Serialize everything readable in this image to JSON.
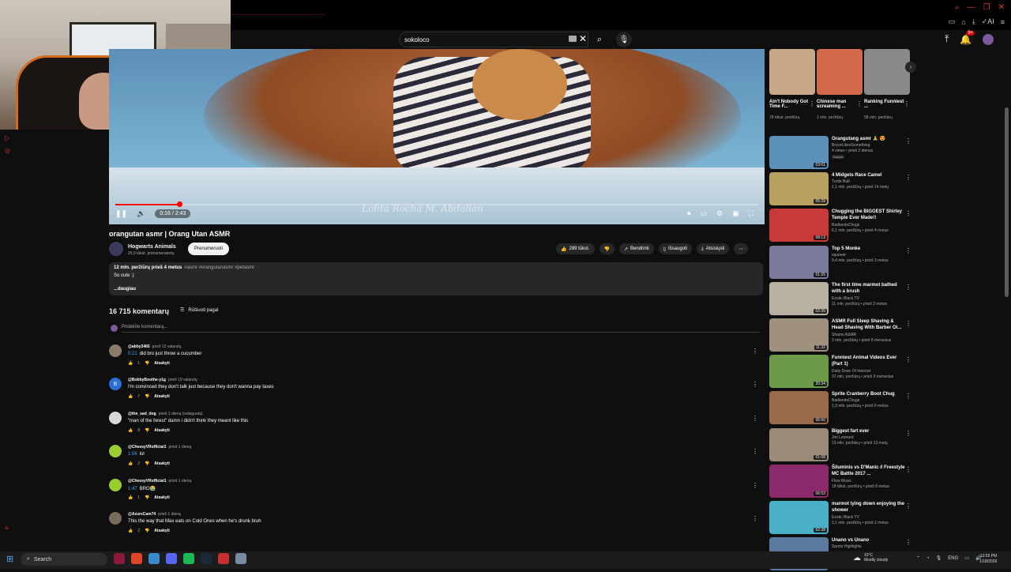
{
  "search": {
    "value": "sokoloco"
  },
  "player": {
    "watermark": "Lolita Rocha M. Abdalian",
    "time": "0:16 / 2:43",
    "progress_fraction": 0.1
  },
  "video": {
    "title": "orangutan asmr | Orang Utan ASMR",
    "channel_name": "Hogwarts Animals",
    "channel_subs": "25,9 tūkst. prenumeratorių",
    "subscribe_label": "Prenumeruoti",
    "likes": "289 tūkst.",
    "share_label": "Bendrinti",
    "save_label": "Išsaugoti",
    "download_label": "Atsisiųsti"
  },
  "description": {
    "meta": "12 mln. peržiūrų prieš 4 metus",
    "tags": "#asmr #orangutanasmr #petasmr",
    "text": "So cute :)",
    "more_label": "...daugiau"
  },
  "comments": {
    "count_label": "16 715 komentarų",
    "sort_label": "Rūšiuoti pagal",
    "add_placeholder": "Pridėkite komentarą...",
    "items": [
      {
        "author": "@abby3465",
        "time": "prieš 13 valandų",
        "timestamp": "0:21",
        "text": "did bro just throw a cucumber",
        "likes": "1",
        "reply": "Atsakyti",
        "avatar_color": "#8a7a6a"
      },
      {
        "author": "@BobbyBoothe-y1g",
        "time": "prieš 19 valandų",
        "timestamp": "",
        "text": "I'm convinced they don't talk just because they don't wanna pay taxes",
        "likes": "7",
        "reply": "Atsakyti",
        "avatar_color": "#2a6fd6",
        "avatar_letter": "B"
      },
      {
        "author": "@the_sad_dog",
        "time": "prieš 1 dieną (redaguota)",
        "timestamp": "",
        "text": "\"man of the forest\" damn i didn't think they meant like this",
        "likes": "8",
        "reply": "Atsakyti",
        "avatar_color": "#d8d8d8"
      },
      {
        "author": "@CheesyVRofficial1",
        "time": "prieš 1 dieną",
        "timestamp": "1:56",
        "text": "lol",
        "likes": "2",
        "reply": "Atsakyti",
        "avatar_color": "#9acd32"
      },
      {
        "author": "@CheesyVRofficial1",
        "time": "prieš 1 dieną",
        "timestamp": "1:47",
        "text": "BRO😭",
        "likes": "1",
        "reply": "Atsakyti",
        "avatar_color": "#9acd32"
      },
      {
        "author": "@AzureCam74",
        "time": "prieš 1 dieną",
        "timestamp": "",
        "text": "This the way that Max eats on Cold Ones when he's drunk bruh",
        "likes": "2",
        "reply": "Atsakyti",
        "avatar_color": "#7a6a5a"
      }
    ]
  },
  "shorts": [
    {
      "title": "Ain't Nobody Got Time F...",
      "views": "78 tūkst. peržiūrų",
      "color": "#c8a888"
    },
    {
      "title": "Chinese man screaming ...",
      "views": "1 mln. peržiūrų",
      "color": "#d06a4a"
    },
    {
      "title": "Ranking Funniest ...",
      "views": "58 mln. peržiūrų",
      "color": "#8a8a8a"
    }
  ],
  "recommendations": [
    {
      "title": "Orangutang asmr 🙏 😍",
      "channel": "BryceLikesSomething",
      "meta": "4 views • prieš 2 dienas",
      "badge": "Naujas",
      "duration": "03:01",
      "color": "#5b90b8"
    },
    {
      "title": "4 Midgets Race Camel",
      "channel": "Turtle Butt",
      "meta": "1,1 mln. peržiūrų • prieš 14 metų",
      "badge": "",
      "duration": "05:39",
      "color": "#b8a060"
    },
    {
      "title": "Chugging the BIGGEST Shirley Temple Ever Made!!",
      "channel": "BadlandsChugs",
      "meta": "6,1 mln. peržiūrų • prieš 4 metus",
      "badge": "",
      "duration": "08:13",
      "color": "#c83a3a"
    },
    {
      "title": "Top 5 Monke",
      "channel": "squeeer",
      "meta": "9,4 mln. peržiūrų • prieš 3 metus",
      "badge": "",
      "duration": "01:25",
      "color": "#7a7a9a"
    },
    {
      "title": "The first time marmot bathed with a brush",
      "channel": "Exotic Black TV",
      "meta": "11 mln. peržiūrų • prieš 2 metus",
      "badge": "",
      "duration": "02:35",
      "color": "#b8b0a0"
    },
    {
      "title": "ASMR Full Sleep Shaving & Head Shaving With Barber Ol...",
      "channel": "Shams ASMR",
      "meta": "2 mln. peržiūrų • prieš 8 mėnesius",
      "badge": "",
      "duration": "11:32",
      "color": "#a09080"
    },
    {
      "title": "Funniest Animal Videos Ever (Part 1)",
      "channel": "Daily Dose Of Internet",
      "meta": "37 mln. peržiūrų • prieš 9 mėnesius",
      "badge": "",
      "duration": "20:34",
      "color": "#6a9a4a"
    },
    {
      "title": "Sprite Cranberry Boot Chug",
      "channel": "BadlandsChugs",
      "meta": "1,3 mln. peržiūrų • prieš 6 metus",
      "badge": "",
      "duration": "05:50",
      "color": "#9a6a4a"
    },
    {
      "title": "Biggest fart ever",
      "channel": "Jim Leonard",
      "meta": "13 mln. peržiūrų • prieš 13 metų",
      "badge": "",
      "duration": "01:08",
      "color": "#9a8a7a"
    },
    {
      "title": "Šiluminis vs D'Manic // Freestyle MC Battle 2017 ...",
      "channel": "Flow Music",
      "meta": "18 tūkst. peržiūrų • prieš 8 metus",
      "badge": "",
      "duration": "06:53",
      "color": "#8a2a6a"
    },
    {
      "title": "marmot lying down enjoying the shower",
      "channel": "Exotic Black TV",
      "meta": "3,1 mln. peržiūrų • prieš 2 metus",
      "badge": "",
      "duration": "02:38",
      "color": "#4ab0c8"
    },
    {
      "title": "Unano vs Unano",
      "channel": "Sports Highlights",
      "meta": "",
      "badge": "",
      "duration": "",
      "color": "#5a7aa0"
    }
  ],
  "taskbar": {
    "search_label": "Search",
    "weather_temp": "15°C",
    "weather_desc": "Mostly cloudy",
    "lang": "ENG",
    "time": "13:55 PM",
    "date": "1/18/2026"
  },
  "colors": {
    "accent_red": "#ff0000",
    "link_blue": "#3ea6ff",
    "bg": "#0f0f0f",
    "pill": "#272727"
  }
}
